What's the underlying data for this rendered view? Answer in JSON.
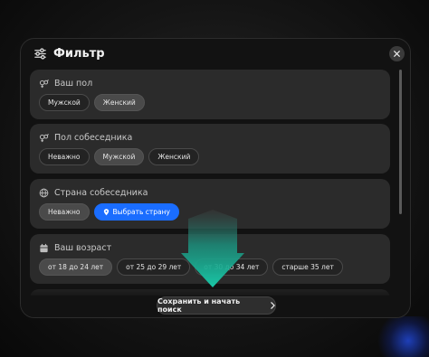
{
  "modal": {
    "title": "Фильтр",
    "sections": [
      {
        "heading": "Ваш пол",
        "icon": "gender-icon",
        "options": [
          {
            "label": "Мужской",
            "selected": false
          },
          {
            "label": "Женский",
            "selected": true
          }
        ]
      },
      {
        "heading": "Пол собеседника",
        "icon": "gender-icon",
        "options": [
          {
            "label": "Неважно",
            "selected": false
          },
          {
            "label": "Мужской",
            "selected": true
          },
          {
            "label": "Женский",
            "selected": false
          }
        ]
      },
      {
        "heading": "Страна собеседника",
        "icon": "globe-icon",
        "options": [
          {
            "label": "Неважно",
            "selected": true
          },
          {
            "label": "Выбрать страну",
            "selected": false,
            "accent": "#1a6dff"
          }
        ]
      },
      {
        "heading": "Ваш возраст",
        "icon": "calendar-icon",
        "options": [
          {
            "label": "от 18 до 24 лет",
            "selected": true
          },
          {
            "label": "от 25 до 29 лет",
            "selected": false
          },
          {
            "label": "от 30 до 34 лет",
            "selected": false
          },
          {
            "label": "старше 35 лет",
            "selected": false
          }
        ]
      }
    ],
    "submit_label": "Сохранить и начать поиск"
  },
  "colors": {
    "accent": "#1a6dff",
    "overlay_arrow": "#19c7a6"
  }
}
